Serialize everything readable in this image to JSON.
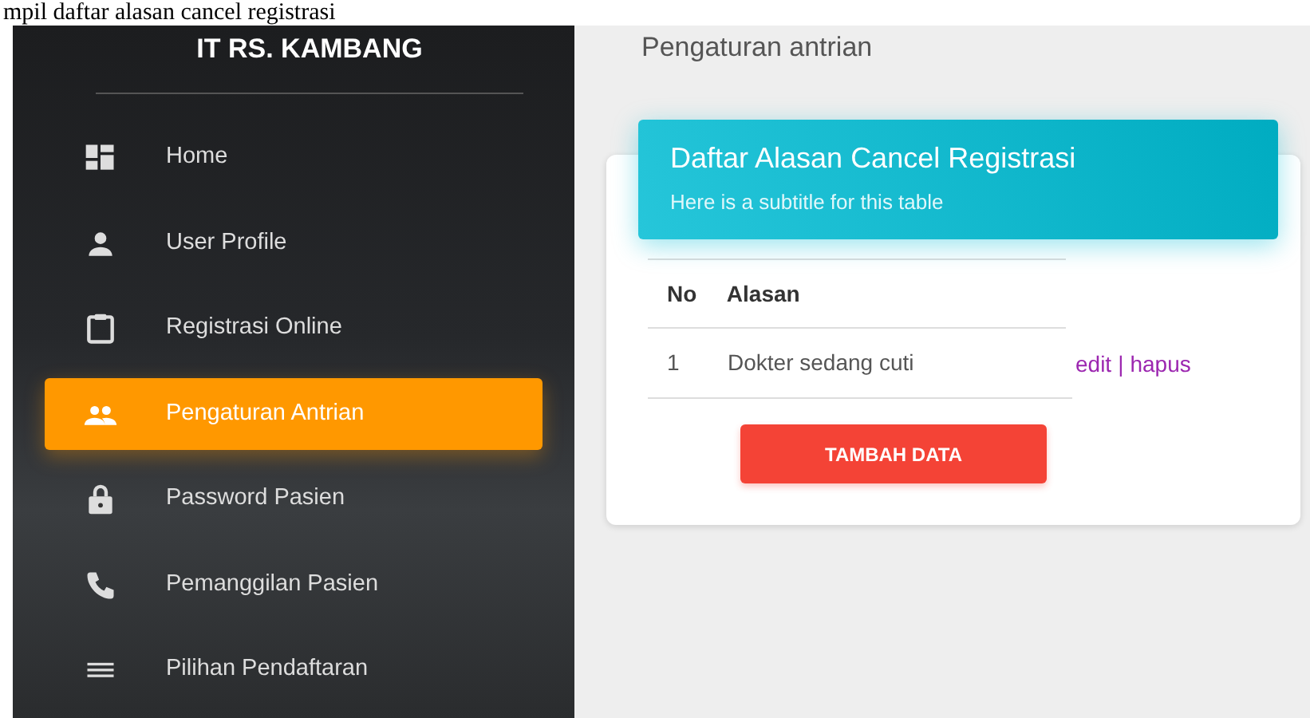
{
  "caption": "mpil daftar alasan cancel registrasi",
  "sidebar": {
    "brand": "IT RS. KAMBANG",
    "items": [
      {
        "label": "Home",
        "selected": false
      },
      {
        "label": "User Profile",
        "selected": false
      },
      {
        "label": "Registrasi Online",
        "selected": false
      },
      {
        "label": "Pengaturan Antrian",
        "selected": true
      },
      {
        "label": "Password Pasien",
        "selected": false
      },
      {
        "label": "Pemanggilan Pasien",
        "selected": false
      },
      {
        "label": "Pilihan Pendaftaran",
        "selected": false
      }
    ]
  },
  "page_title": "Pengaturan antrian",
  "card": {
    "title": "Daftar Alasan Cancel Registrasi",
    "subtitle": "Here is a subtitle for this table",
    "table": {
      "columns": [
        "No",
        "Alasan"
      ],
      "rows": [
        {
          "no": "1",
          "alasan": "Dokter sedang cuti",
          "actions": [
            "edit",
            "hapus"
          ],
          "separator": "|"
        }
      ]
    },
    "button": "TAMBAH DATA"
  }
}
